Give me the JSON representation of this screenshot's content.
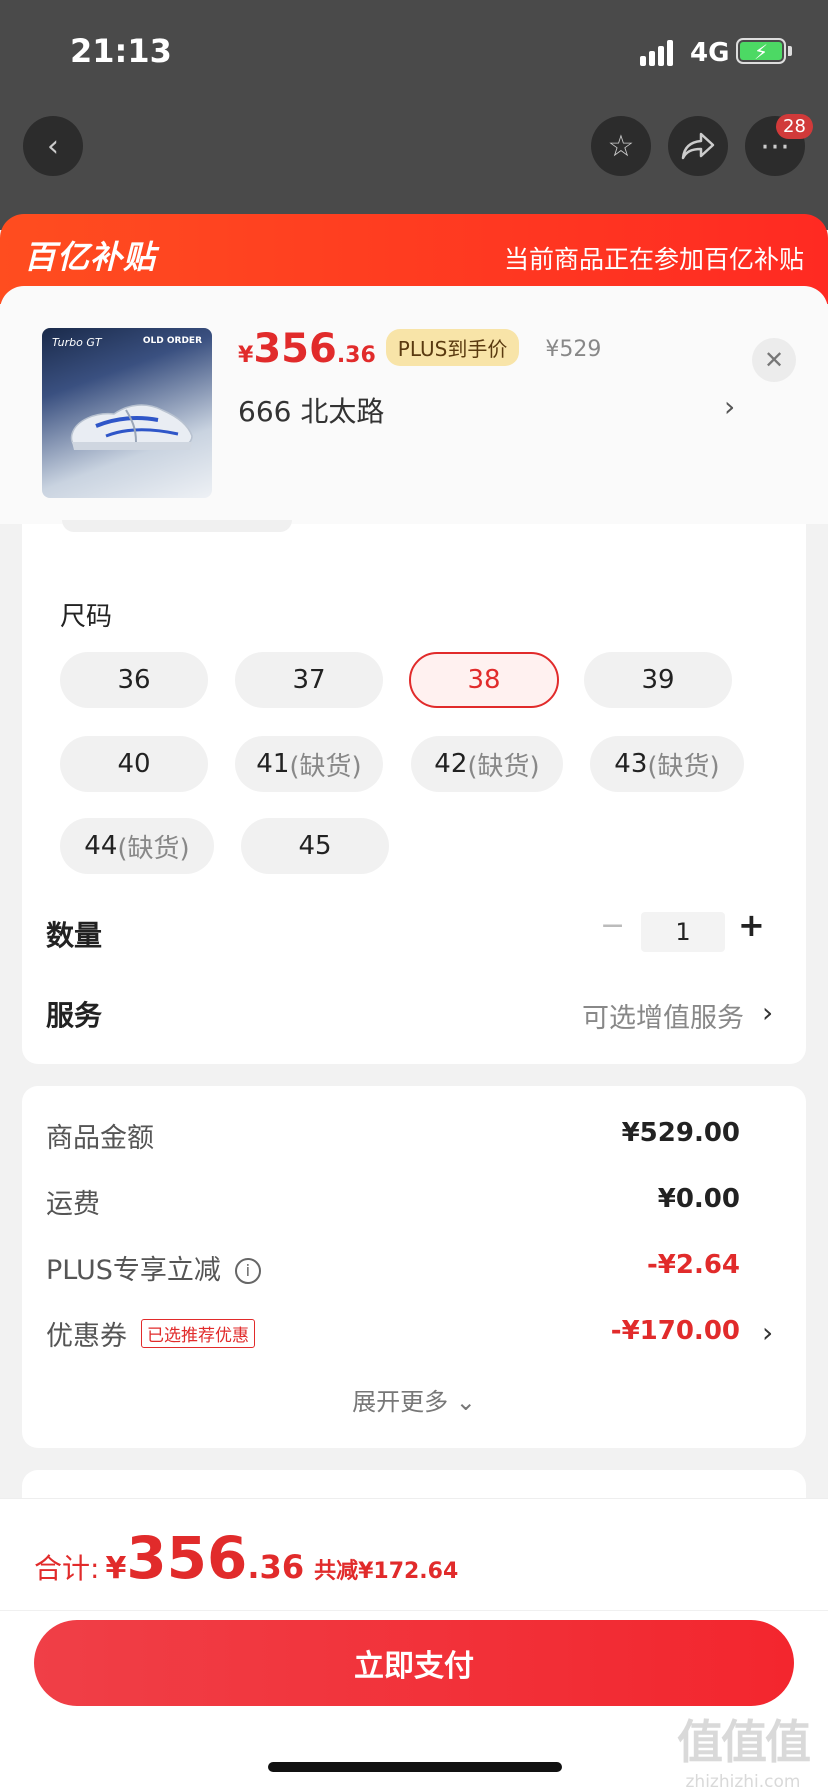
{
  "status": {
    "time": "21:13",
    "network": "4G"
  },
  "header": {
    "more_badge": "28"
  },
  "banner": {
    "logo": "百亿补贴",
    "note": "当前商品正在参加百亿补贴"
  },
  "product": {
    "thumb_brand": "Turbo GT",
    "thumb_model": "OLD ORDER",
    "price_symbol": "¥",
    "price_int": "356",
    "price_dec": ".36",
    "plus_badge": "PLUS到手价",
    "original_price": "¥529",
    "spec": "666  北太路",
    "spec_chevron": "›"
  },
  "options": {
    "size_title": "尺码",
    "sizes": [
      {
        "num": "36",
        "oos": ""
      },
      {
        "num": "37",
        "oos": ""
      },
      {
        "num": "38",
        "oos": ""
      },
      {
        "num": "39",
        "oos": ""
      },
      {
        "num": "40",
        "oos": ""
      },
      {
        "num": "41",
        "oos": "(缺货)"
      },
      {
        "num": "42",
        "oos": "(缺货)"
      },
      {
        "num": "43",
        "oos": "(缺货)"
      },
      {
        "num": "44",
        "oos": "(缺货)"
      },
      {
        "num": "45",
        "oos": ""
      }
    ],
    "selected_size": "38",
    "quantity_label": "数量",
    "quantity_minus": "−",
    "quantity_value": "1",
    "quantity_plus": "+",
    "service_label": "服务",
    "service_value": "可选增值服务",
    "service_chevron": "›"
  },
  "breakdown": {
    "goods_label": "商品金额",
    "goods_value": "¥529.00",
    "shipping_label": "运费",
    "shipping_value": "¥0.00",
    "plus_label": "PLUS专享立减",
    "plus_info": "i",
    "plus_value": "-¥2.64",
    "coupon_label": "优惠券",
    "coupon_tag": "已选推荐优惠",
    "coupon_value": "-¥170.00",
    "coupon_chevron": "›",
    "expand": "展开更多 ⌄"
  },
  "bottom": {
    "total_label": "合计:",
    "total_symbol": "¥",
    "total_int": "356",
    "total_dec": ".36",
    "total_saved": "共减¥172.64",
    "pay_label": "立即支付"
  },
  "watermark": {
    "big": "值值值",
    "small": "zhizhizhi.com"
  },
  "colors": {
    "accent": "#e12b2b",
    "banner": "#ff3a22",
    "plus_badge": "#f8e4a8"
  }
}
